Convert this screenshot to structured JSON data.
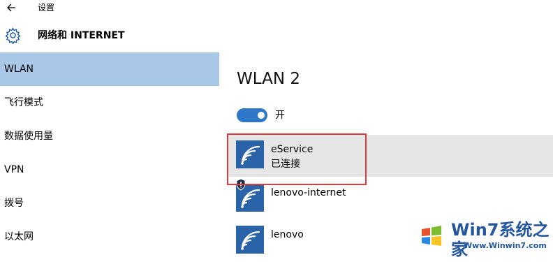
{
  "titlebar": {
    "title": "设置"
  },
  "header": {
    "title": "网络和 INTERNET"
  },
  "sidebar": {
    "items": [
      {
        "label": "WLAN",
        "selected": true
      },
      {
        "label": "飞行模式"
      },
      {
        "label": "数据使用量"
      },
      {
        "label": "VPN"
      },
      {
        "label": "拨号"
      },
      {
        "label": "以太网"
      }
    ]
  },
  "main": {
    "title": "WLAN 2",
    "toggle": {
      "state": "on",
      "label": "开"
    },
    "networks": [
      {
        "name": "eService",
        "status": "已连接",
        "selected": true
      },
      {
        "name": "lenovo-internet",
        "secured_warning": true
      },
      {
        "name": "lenovo"
      }
    ]
  },
  "watermark": {
    "brand": "Win7系统之家",
    "url": "Www.Winwin7.com"
  },
  "colors": {
    "accent": "#2f78c9",
    "sidebar_selected": "#a9c7e6",
    "highlight": "#e03a3a",
    "tile": "#2a63a8"
  }
}
